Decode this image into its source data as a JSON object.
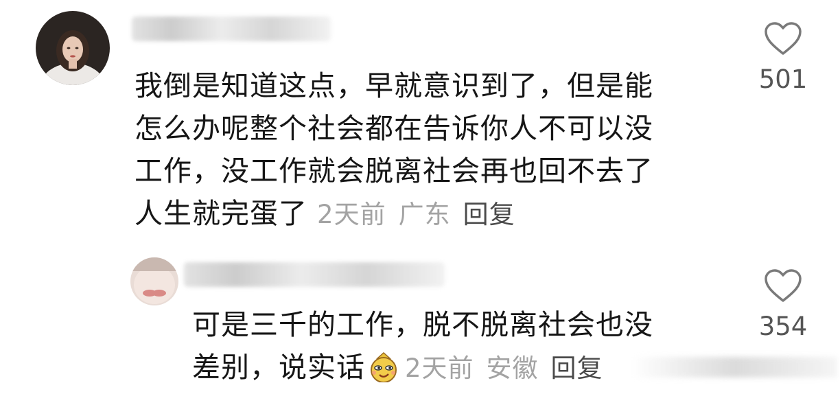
{
  "comments": [
    {
      "text_lines": [
        "我倒是知道这点，早就意识到了，但是能",
        "怎么办呢整个社会都在告诉你人不可以没",
        "工作，没工作就会脱离社会再也回不去了",
        "人生就完蛋了"
      ],
      "time": "2天前",
      "location": "广东",
      "reply_label": "回复",
      "likes": "501"
    },
    {
      "text_lines": [
        "可是三千的工作，脱不脱离社会也没",
        "差别，说实话"
      ],
      "emoji": "smirk-emoji-icon",
      "time": "2天前",
      "location": "安徽",
      "reply_label": "回复",
      "likes": "354"
    }
  ],
  "colors": {
    "meta": "#a3a3a3",
    "text": "#161616",
    "icon": "#7a7a7a"
  }
}
